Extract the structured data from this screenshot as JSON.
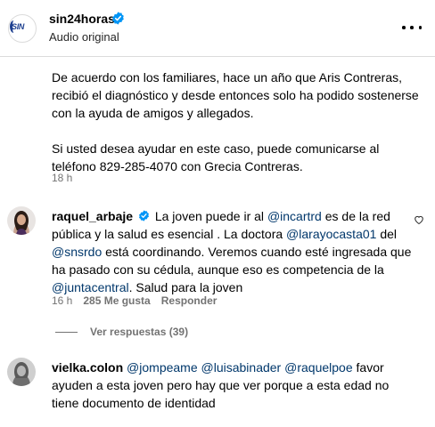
{
  "post": {
    "username": "sin24horas",
    "subtitle": "Audio original",
    "logo_text": "SIN",
    "caption_p1": "De acuerdo con los familiares, hace un año que Aris Contreras, recibió el diagnóstico y desde entonces solo ha podido sostenerse con la ayuda de amigos y allegados.",
    "caption_p2": "Si usted desea ayudar en este caso, puede comunicarse al teléfono 829-285-4070 con Grecia Contreras.",
    "time": "18 h"
  },
  "comments": [
    {
      "username": "raquel_arbaje",
      "t1": "La joven puede ir al ",
      "m1": "@incartrd",
      "t2": " es de la red pública y la salud es esencial . La doctora ",
      "m2": "@larayocasta01",
      "t3": " del ",
      "m3": "@snsrdo",
      "t4": " está coordinando. Veremos cuando esté ingresada que ha pasado con su cédula, aunque eso es competencia de la ",
      "m4": "@juntacentral",
      "t5": ". Salud para la joven",
      "time": "16 h",
      "likes": "285 Me gusta",
      "reply": "Responder",
      "view_replies": "Ver respuestas (39)"
    },
    {
      "username": "vielka.colon",
      "m1": "@jompeame",
      "m2": "@luisabinader",
      "m3": "@raquelpoe",
      "t1": " favor ayuden a esta joven pero hay que ver porque a esta edad no tiene documento de identidad"
    }
  ],
  "colors": {
    "mention": "#00376b",
    "verified": "#0095f6",
    "secondary_text": "#737373"
  },
  "icons": [
    "verified-icon",
    "more-options-icon",
    "heart-icon"
  ]
}
